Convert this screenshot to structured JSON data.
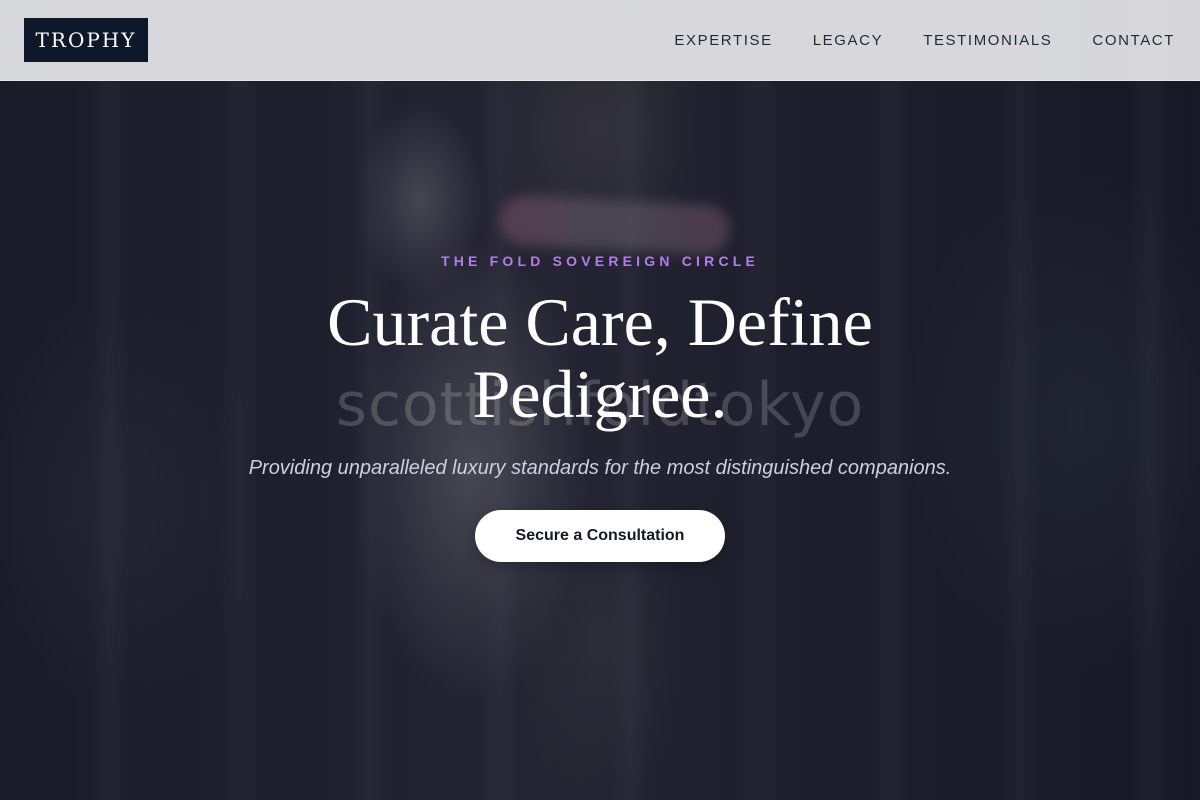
{
  "header": {
    "logo_text": "TROPHY",
    "nav": [
      {
        "label": "EXPERTISE"
      },
      {
        "label": "LEGACY"
      },
      {
        "label": "TESTIMONIALS"
      },
      {
        "label": "CONTACT"
      }
    ]
  },
  "hero": {
    "eyebrow": "THE FOLD SOVEREIGN CIRCLE",
    "headline": "Curate Care, Define Pedigree.",
    "watermark": "scottishfoldtokyo",
    "subtitle": "Providing unparalleled luxury standards for the most distinguished companions.",
    "cta_label": "Secure a Consultation"
  },
  "colors": {
    "accent": "#b57ce8",
    "logo_bg": "#0f172a",
    "header_bg": "#e6e6e9",
    "cta_bg": "#ffffff"
  }
}
